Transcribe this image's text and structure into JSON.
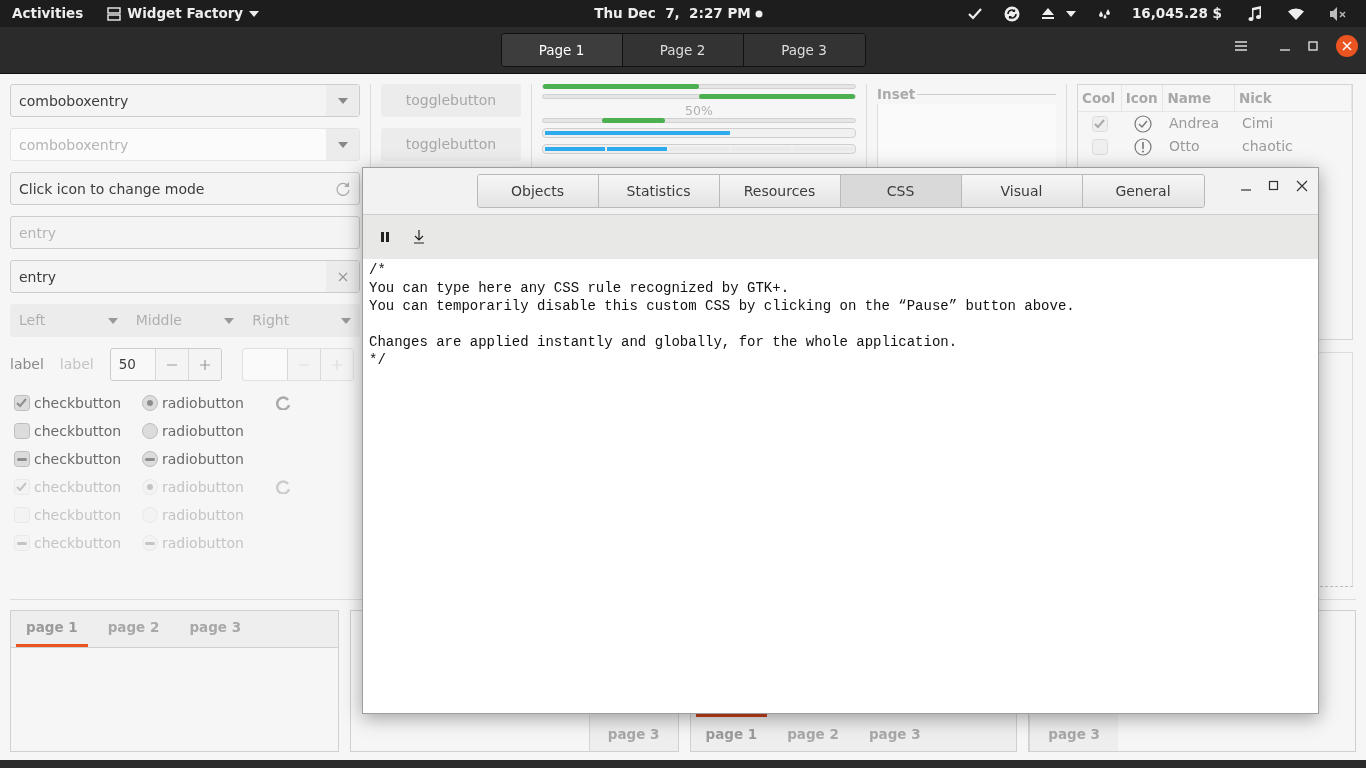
{
  "top_bar": {
    "activities": "Activities",
    "app_menu": "Widget Factory",
    "clock": "Thu Dec  7,  2:27 PM",
    "balance": "16,045.28 $"
  },
  "header_bar": {
    "pages": [
      {
        "label": "Page 1",
        "selected": true
      },
      {
        "label": "Page 2",
        "selected": false
      },
      {
        "label": "Page 3",
        "selected": false
      }
    ]
  },
  "entries": [
    {
      "kind": "combo",
      "value": "comboboxentry",
      "disabled": false
    },
    {
      "kind": "combo",
      "value": "comboboxentry",
      "disabled": true
    },
    {
      "kind": "mode",
      "value": "Click icon to change mode",
      "disabled": false
    },
    {
      "kind": "plain",
      "placeholder": "entry",
      "disabled": false
    },
    {
      "kind": "clear",
      "value": "entry",
      "disabled": false
    }
  ],
  "linked_combos": [
    {
      "label": "Left"
    },
    {
      "label": "Middle"
    },
    {
      "label": "Right"
    }
  ],
  "labels": [
    {
      "text": "label",
      "disabled": false
    },
    {
      "text": "label",
      "disabled": true
    }
  ],
  "spin_buttons": [
    {
      "value": "50",
      "disabled": false
    },
    {
      "disabled": true
    }
  ],
  "check_rows": [
    {
      "check": {
        "label": "checkbutton",
        "checked": true,
        "inconsistent": false
      },
      "radio": {
        "label": "radiobutton",
        "checked": true,
        "inconsistent": false
      },
      "spinner": true,
      "disabled": false
    },
    {
      "check": {
        "label": "checkbutton",
        "checked": false,
        "inconsistent": false
      },
      "radio": {
        "label": "radiobutton",
        "checked": false,
        "inconsistent": false
      },
      "spinner": false,
      "disabled": false
    },
    {
      "check": {
        "label": "checkbutton",
        "checked": false,
        "inconsistent": true
      },
      "radio": {
        "label": "radiobutton",
        "checked": false,
        "inconsistent": true
      },
      "spinner": false,
      "disabled": false
    },
    {
      "check": {
        "label": "checkbutton",
        "checked": true,
        "inconsistent": false
      },
      "radio": {
        "label": "radiobutton",
        "checked": true,
        "inconsistent": false
      },
      "spinner": true,
      "disabled": true
    },
    {
      "check": {
        "label": "checkbutton",
        "checked": false,
        "inconsistent": false
      },
      "radio": {
        "label": "radiobutton",
        "checked": false,
        "inconsistent": false
      },
      "spinner": false,
      "disabled": true
    },
    {
      "check": {
        "label": "checkbutton",
        "checked": false,
        "inconsistent": true
      },
      "radio": {
        "label": "radiobutton",
        "checked": false,
        "inconsistent": true
      },
      "spinner": false,
      "disabled": true
    }
  ],
  "toggles": [
    {
      "label": "togglebutton"
    },
    {
      "label": "togglebutton"
    }
  ],
  "progress": [
    {
      "kind": "progress",
      "level": 0.5,
      "inverted": false
    },
    {
      "kind": "progress",
      "level": 0.5,
      "inverted": true
    },
    {
      "kind": "text",
      "text": "50%"
    },
    {
      "kind": "pulse"
    },
    {
      "kind": "levelbar",
      "level": 0.6
    },
    {
      "kind": "segments",
      "level": 0.4
    }
  ],
  "inset": {
    "title": "Inset"
  },
  "tree": {
    "columns": [
      "Cool",
      "Icon",
      "Name",
      "Nick"
    ],
    "rows": [
      {
        "cool": true,
        "name": "Andrea",
        "nick": "Cimi"
      },
      {
        "cool": false,
        "name": "Otto",
        "nick": "chaotic"
      }
    ]
  },
  "notebooks": [
    {
      "kind": "top",
      "tabs": [
        {
          "label": "page 1",
          "selected": true
        },
        {
          "label": "page 2",
          "selected": false
        },
        {
          "label": "page 3",
          "selected": false
        }
      ]
    },
    {
      "kind": "bottom_end",
      "tabs": [
        {
          "label": "page 3",
          "selected": false
        }
      ]
    },
    {
      "kind": "bottom",
      "tabs": [
        {
          "label": "page 1",
          "selected": true
        },
        {
          "label": "page 2",
          "selected": false
        },
        {
          "label": "page 3",
          "selected": false
        }
      ]
    },
    {
      "kind": "bottom",
      "tabs": [
        {
          "label": "page 3",
          "selected": false
        }
      ]
    }
  ],
  "inspector": {
    "tabs": [
      {
        "label": "Objects",
        "selected": false
      },
      {
        "label": "Statistics",
        "selected": false
      },
      {
        "label": "Resources",
        "selected": false
      },
      {
        "label": "CSS",
        "selected": true
      },
      {
        "label": "Visual",
        "selected": false
      },
      {
        "label": "General",
        "selected": false
      }
    ],
    "css_paragraphs": [
      [
        "/*",
        "You can type here any CSS rule recognized by GTK+.",
        "You can temporarily disable this custom CSS by clicking on the “Pause” button above."
      ],
      [
        "Changes are applied instantly and globally, for the whole application.",
        "*/"
      ]
    ]
  }
}
